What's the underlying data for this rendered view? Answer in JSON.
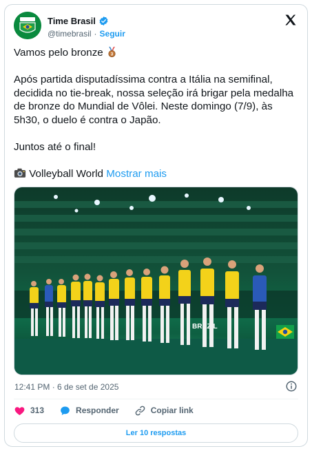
{
  "author": {
    "name": "Time Brasil",
    "handle": "@timebrasil",
    "follow_label": "Seguir",
    "separator": "·"
  },
  "tweet": {
    "lines": [
      "Vamos pelo bronze",
      "Após partida disputadíssima contra a Itália na semifinal, decidida no tie-break, nossa seleção irá brigar pela medalha de bronze do Mundial de Vôlei. Neste domingo (7/9), às 5h30, o duelo é contra o Japão.",
      "Juntos até o final!",
      "Volleyball World"
    ],
    "show_more": "Mostrar mais",
    "medal_emoji": "3rd-place-medal-icon",
    "camera_emoji": "camera-icon"
  },
  "media": {
    "court_board_text": "BRAZIL"
  },
  "meta": {
    "timestamp": "12:41 PM · 6 de set de 2025"
  },
  "actions": {
    "likes": "313",
    "reply_label": "Responder",
    "copy_label": "Copiar link"
  },
  "replies_button": "Ler 10 respostas",
  "colors": {
    "accent": "#1d9bf0",
    "like": "#f91880",
    "text": "#0f1419",
    "muted": "#536471"
  }
}
